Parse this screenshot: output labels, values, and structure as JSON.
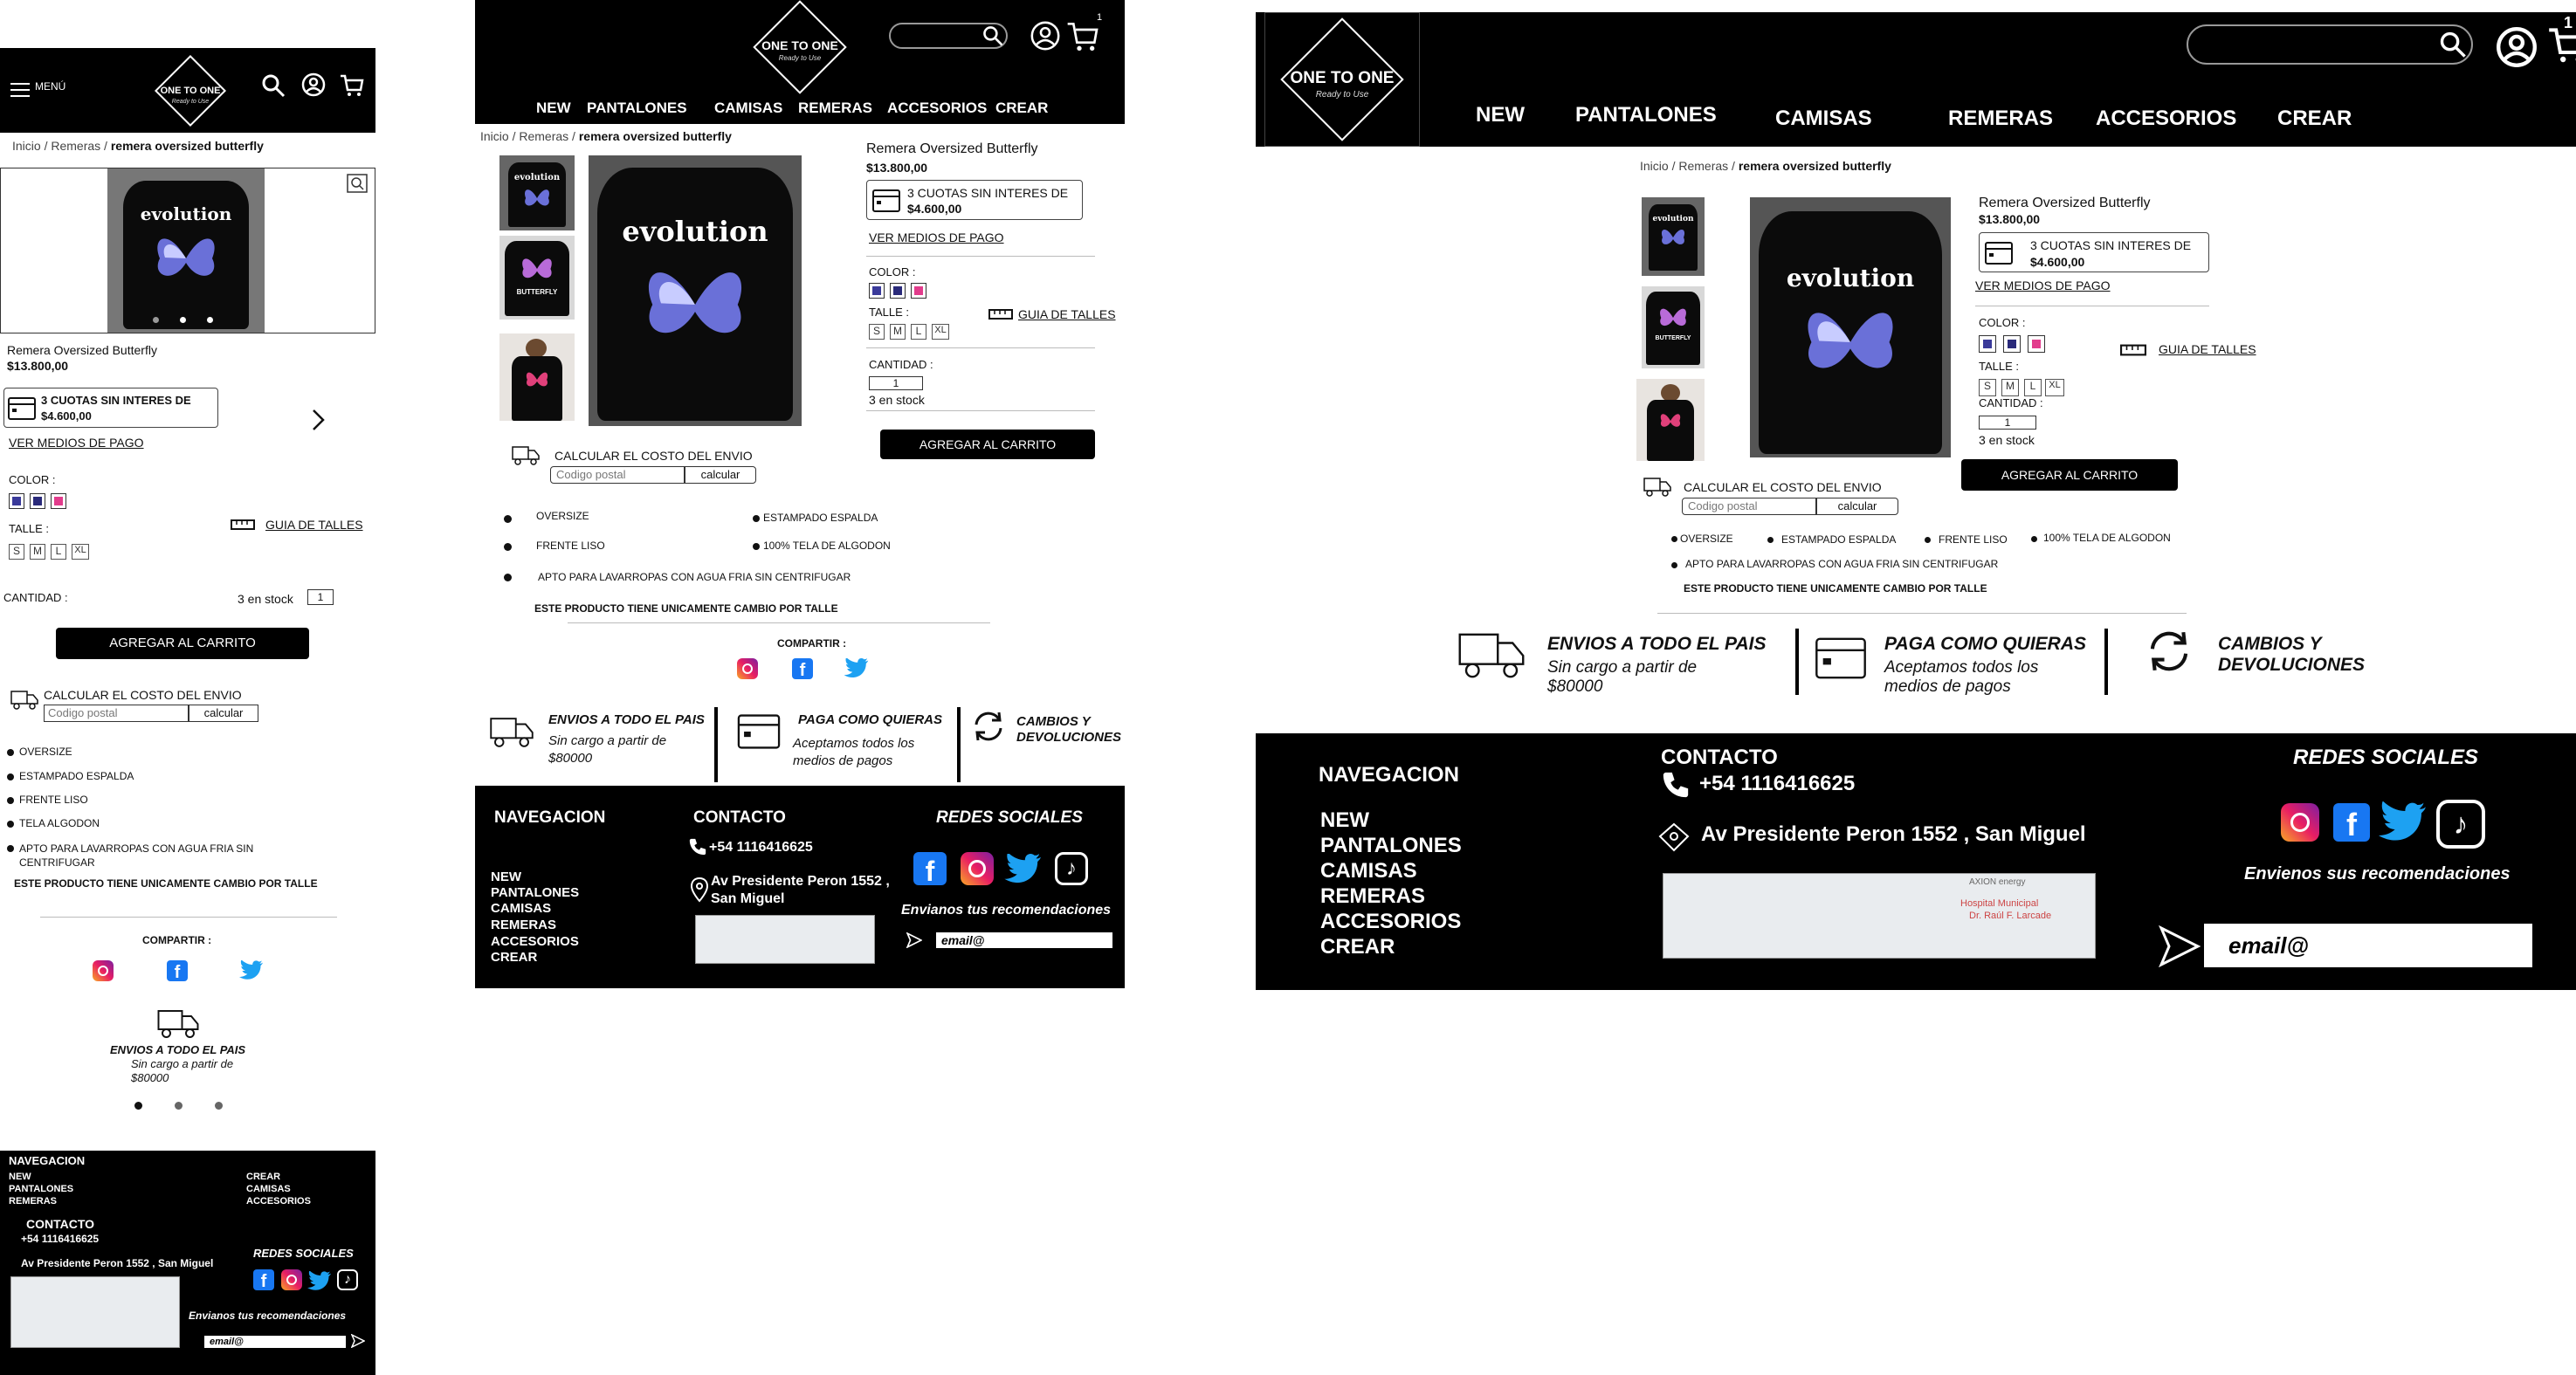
{
  "brand": {
    "name": "ONE TO ONE",
    "tagline": "Ready to Use"
  },
  "menu_label": "MENÚ",
  "cart_count": "1",
  "nav": [
    "NEW",
    "PANTALONES",
    "CAMISAS",
    "REMERAS",
    "ACCESORIOS",
    "CREAR"
  ],
  "breadcrumb": {
    "home": "Inicio",
    "sep": "/",
    "category": "Remeras",
    "current": "remera oversized butterfly"
  },
  "product": {
    "name": "Remera Oversized Butterfly",
    "price": "$13.800,00",
    "installments_line1": "3 CUOTAS SIN INTERES DE",
    "installments_line2": "$4.600,00",
    "payment_link": "VER MEDIOS DE PAGO",
    "color_label": "COLOR :",
    "colors": [
      "#3a3a9a",
      "#2a2a7a",
      "#e23c8c"
    ],
    "size_label": "TALLE :",
    "sizes": [
      "S",
      "M",
      "L",
      "XL"
    ],
    "size_guide": "GUIA DE TALLES",
    "qty_label": "CANTIDAD :",
    "qty_value": "1",
    "stock": "3 en stock",
    "add_to_cart": "AGREGAR AL CARRITO",
    "shirt_print": "evolution",
    "thumb_print": "BUTTERFLY"
  },
  "shipping": {
    "label": "CALCULAR EL COSTO DEL ENVIO",
    "placeholder": "Codigo postal",
    "button": "calcular"
  },
  "features": [
    "OVERSIZE",
    "ESTAMPADO ESPALDA",
    "FRENTE LISO",
    "100% TELA DE ALGODON",
    "APTO PARA LAVARROPAS CON AGUA FRIA SIN CENTRIFUGAR"
  ],
  "mobile_features": [
    "OVERSIZE",
    "ESTAMPADO ESPALDA",
    "FRENTE LISO",
    "TELA ALGODON",
    "APTO PARA LAVARROPAS CON AGUA FRIA SIN",
    "CENTRIFUGAR"
  ],
  "exchange_note": "ESTE PRODUCTO TIENE UNICAMENTE CAMBIO POR TALLE",
  "share_label": "COMPARTIR :",
  "benefits": [
    {
      "title": "ENVIOS A TODO EL PAIS",
      "line1": "Sin cargo a partir de",
      "line2": "$80000"
    },
    {
      "title": "PAGA COMO QUIERAS",
      "line1": "Aceptamos todos los",
      "line2": "medios de pagos"
    },
    {
      "title": "CAMBIOS Y",
      "line1": "DEVOLUCIONES",
      "line2": ""
    }
  ],
  "footer": {
    "nav_title": "NAVEGACION",
    "contact_title": "CONTACTO",
    "phone": "+54 1116416625",
    "address": "Av Presidente Peron 1552 , San Miguel",
    "address_l1": "Av Presidente Peron 1552 ,",
    "address_l2": "San Miguel",
    "social_title": "REDES SOCIALES",
    "reco_text": "Envianos tus recomendaciones",
    "reco_text_lg": "Envienos sus recomendaciones",
    "email_placeholder": "email@",
    "map_label1": "Hospital Municipal",
    "map_label2": "Dr. Raúl F. Larcade",
    "map_label3": "AXION energy"
  }
}
